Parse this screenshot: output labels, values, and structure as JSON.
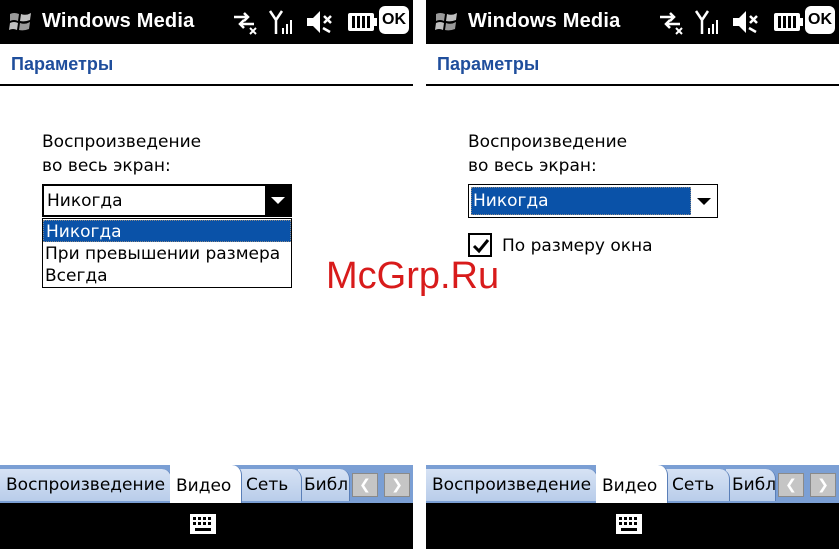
{
  "watermark": "McGrp.Ru",
  "colors": {
    "accent": "#0a52a8",
    "header_title": "#1f4e9c",
    "tabbar": "#7b9fd4",
    "watermark": "#d81b1b"
  },
  "left": {
    "titlebar": {
      "title": "Windows Media",
      "ok_label": "OK",
      "icons": [
        "windows-logo-icon",
        "sync-icon",
        "signal-icon",
        "speaker-muted-icon",
        "battery-icon"
      ]
    },
    "header": {
      "title": "Параметры"
    },
    "label_line1": "Воспроизведение",
    "label_line2": "во весь экран:",
    "select_value": "Никогда",
    "dropdown_options": [
      "Никогда",
      "При превышении размера",
      "Всегда"
    ],
    "tabs": [
      "Воспроизведение",
      "Видео",
      "Сеть",
      "Библ"
    ],
    "active_tab": "Видео"
  },
  "right": {
    "titlebar": {
      "title": "Windows Media",
      "ok_label": "OK"
    },
    "header": {
      "title": "Параметры"
    },
    "label_line1": "Воспроизведение",
    "label_line2": "во весь экран:",
    "select_value": "Никогда",
    "checkbox_label": "По размеру окна",
    "checkbox_checked": true,
    "tabs": [
      "Воспроизведение",
      "Видео",
      "Сеть",
      "Библ"
    ],
    "active_tab": "Видео"
  }
}
